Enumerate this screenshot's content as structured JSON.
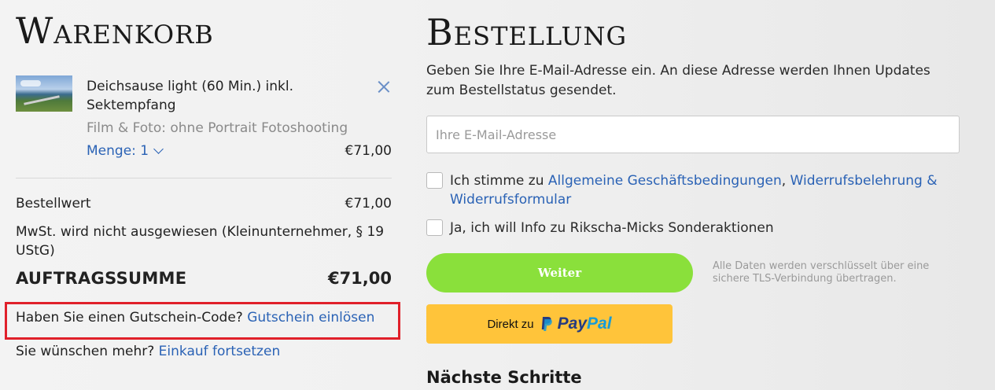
{
  "cart": {
    "heading": "Warenkorb",
    "item": {
      "title": "Deichsause light (60 Min.) inkl. Sektempfang",
      "variant": "Film & Foto: ohne Portrait Fotoshooting",
      "quantity_label": "Menge: 1",
      "price": "€71,00",
      "remove_icon": "close-icon",
      "quantity_icon": "chevron-down-icon"
    },
    "subtotal_label": "Bestellwert",
    "subtotal_value": "€71,00",
    "vat_note": "MwSt. wird nicht ausgewiesen (Kleinunternehmer, § 19 UStG)",
    "total_label": "AUFTRAGSSUMME",
    "total_value": "€71,00",
    "coupon_question": "Haben Sie einen Gutschein-Code?",
    "coupon_link": "Gutschein einlösen",
    "more_question": "Sie wünschen mehr?",
    "more_link": "Einkauf fortsetzen",
    "highlight_color": "#e0202a"
  },
  "order": {
    "heading": "Bestellung",
    "intro": "Geben Sie Ihre E-Mail-Adresse ein. An diese Adresse werden Ihnen Updates zum Bestellstatus gesendet.",
    "email_placeholder": "Ihre E-Mail-Adresse",
    "email_value": "",
    "terms_prefix": "Ich stimme zu",
    "terms_link_1": "Allgemeine Geschäftsbedingungen",
    "terms_separator": ",",
    "terms_link_2": "Widerrufsbelehrung & Widerrufsformular",
    "terms_checked": false,
    "newsletter_label": "Ja, ich will Info zu Rikscha-Micks Sonderaktionen",
    "newsletter_checked": false,
    "continue_button": "Weiter",
    "continue_color": "#8ae03b",
    "secure_note": "Alle Daten werden verschlüsselt über eine sichere TLS-Verbindung übertragen.",
    "paypal_prefix": "Direkt zu",
    "paypal_pay": "Pay",
    "paypal_pal": "Pal",
    "paypal_icon": "paypal-icon",
    "paypal_color": "#ffc43a",
    "next_steps": "Nächste Schritte"
  },
  "colors": {
    "link": "#2a62b5"
  }
}
